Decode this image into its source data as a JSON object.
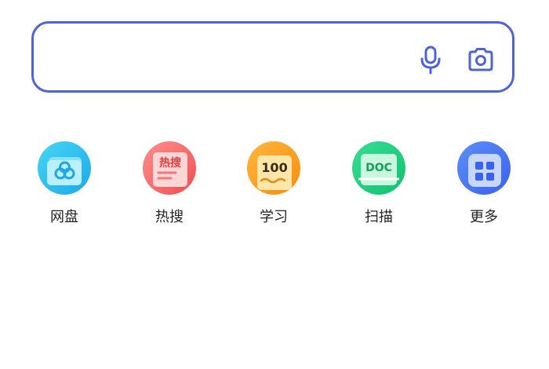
{
  "search": {
    "value": "",
    "placeholder": ""
  },
  "icons": {
    "mic": "microphone-icon",
    "camera": "camera-icon"
  },
  "colors": {
    "search_border": "#4e64d6",
    "netdisk": "#1da7e8",
    "hot_search": "#f04e4e",
    "study": "#f98c0f",
    "scan": "#14bf6e",
    "more": "#3a62ec"
  },
  "shortcuts": [
    {
      "label": "网盘",
      "icon": "cloud-drive-icon"
    },
    {
      "label": "热搜",
      "icon": "hot-search-icon",
      "icon_text": "热搜"
    },
    {
      "label": "学习",
      "icon": "study-icon",
      "icon_text": "100"
    },
    {
      "label": "扫描",
      "icon": "scan-doc-icon",
      "icon_text": "DOC"
    },
    {
      "label": "更多",
      "icon": "more-grid-icon"
    }
  ]
}
